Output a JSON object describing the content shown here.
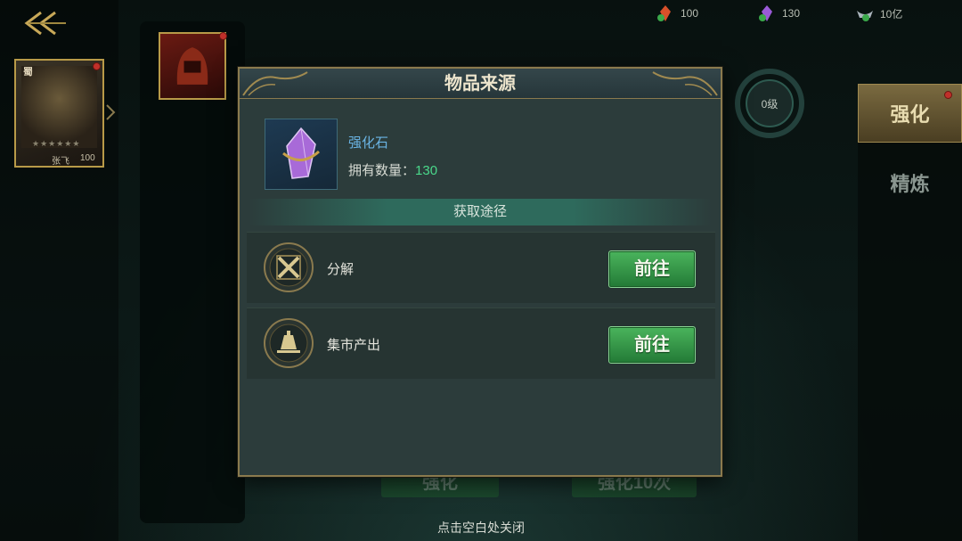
{
  "currencies": [
    {
      "icon": "red-gem-icon",
      "value": "100"
    },
    {
      "icon": "purple-gem-icon",
      "value": "130"
    },
    {
      "icon": "silver-ingot-icon",
      "value": "10亿"
    }
  ],
  "hero": {
    "faction": "蜀",
    "stars": "★★★★★★",
    "name": "张飞",
    "level": "100"
  },
  "level_ring": {
    "label": "0级"
  },
  "tabs": [
    {
      "label": "强化",
      "active": true
    },
    {
      "label": "精炼",
      "active": false
    }
  ],
  "background_buttons": [
    "强化",
    "强化10次"
  ],
  "dialog": {
    "title": "物品来源",
    "item": {
      "name": "强化石",
      "owned_label": "拥有数量：",
      "owned_value": "130",
      "icon": "purple-crystal-icon"
    },
    "section_title": "获取途径",
    "sources": [
      {
        "icon": "decompose-icon",
        "label": "分解",
        "button": "前往"
      },
      {
        "icon": "market-bell-icon",
        "label": "集市产出",
        "button": "前往"
      }
    ]
  },
  "close_hint": "点击空白处关闭",
  "colors": {
    "accent_gold": "#8a7a4e",
    "go_button": "#3a9a4a",
    "item_name": "#6ab4e4",
    "count": "#4ad88a"
  }
}
